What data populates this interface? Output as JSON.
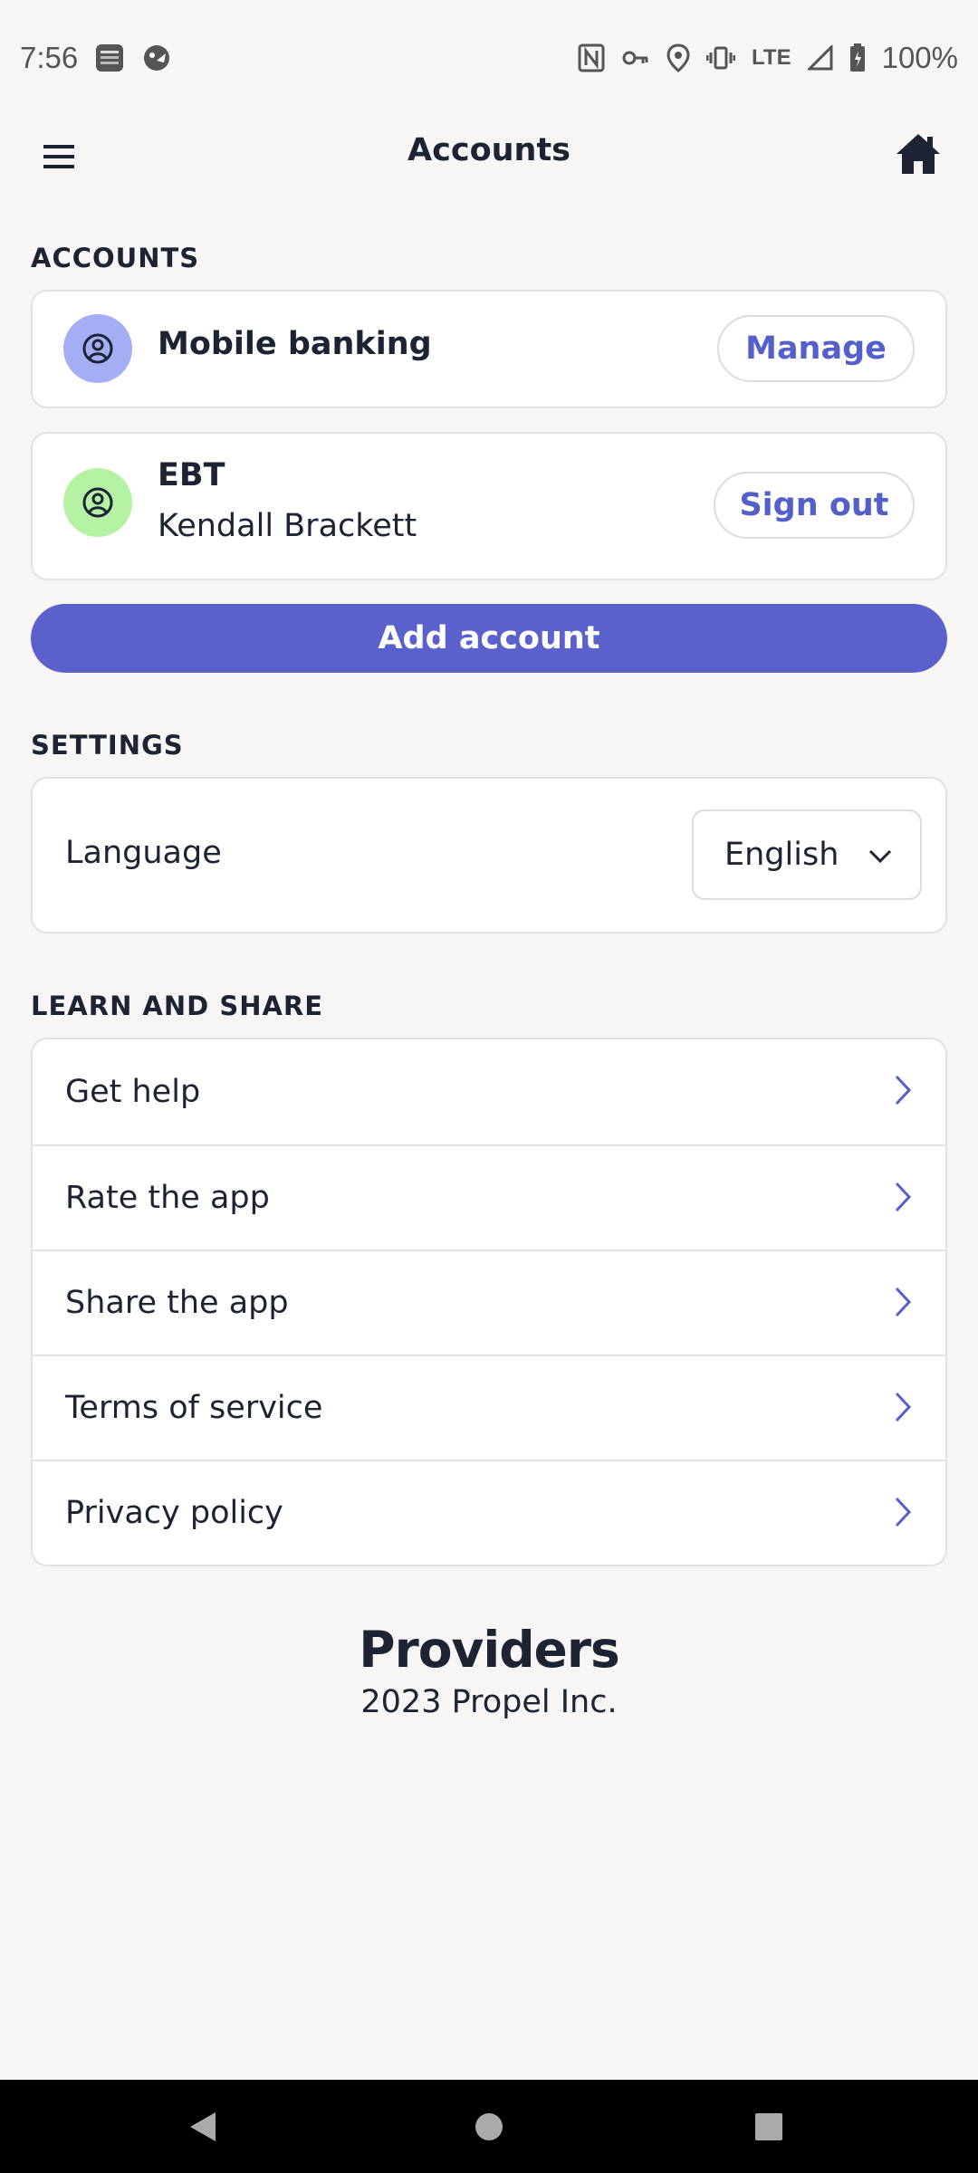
{
  "status_bar": {
    "time": "7:56",
    "network": "LTE",
    "battery": "100%"
  },
  "header": {
    "title": "Accounts"
  },
  "accounts": {
    "section_label": "ACCOUNTS",
    "items": [
      {
        "name": "Mobile banking",
        "subtitle": "",
        "action": "Manage",
        "avatar_color": "#a4aef5"
      },
      {
        "name": "EBT",
        "subtitle": "Kendall Brackett",
        "action": "Sign out",
        "avatar_color": "#b6f2a4"
      }
    ],
    "add_label": "Add account"
  },
  "settings": {
    "section_label": "SETTINGS",
    "language_label": "Language",
    "language_value": "English"
  },
  "learn": {
    "section_label": "LEARN AND SHARE",
    "items": [
      "Get help",
      "Rate the app",
      "Share the app",
      "Terms of service",
      "Privacy policy"
    ]
  },
  "footer": {
    "brand": "Providers",
    "copyright": "2023 Propel Inc."
  },
  "colors": {
    "accent": "#5a60cc",
    "background": "#f8f6f4",
    "text": "#1c2333"
  }
}
